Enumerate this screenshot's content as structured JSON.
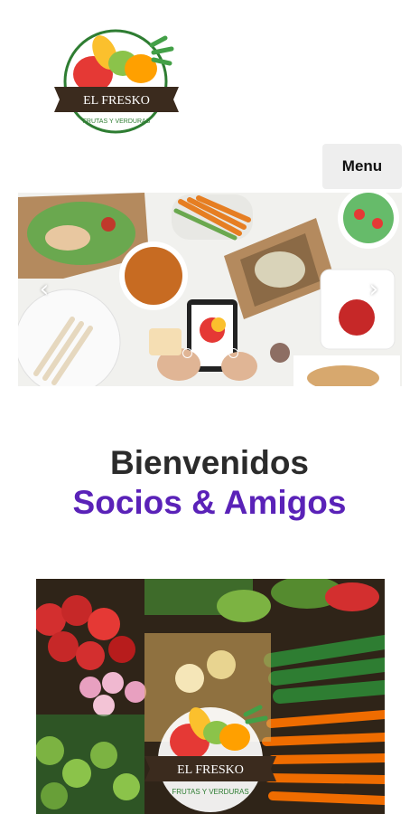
{
  "brand": {
    "name": "EL FRESKO",
    "tagline": "FRUTAS Y VERDURAS"
  },
  "header": {
    "menu_label": "Menu"
  },
  "carousel": {
    "prev_icon": "chevron-left-icon",
    "next_icon": "chevron-right-icon",
    "slide_count": 3,
    "active_slide": 2
  },
  "welcome": {
    "title": "Bienvenidos",
    "subtitle": "Socios & Amigos"
  },
  "colors": {
    "subtitle": "#5a22b8",
    "title": "#2b2b2b",
    "menu_bg": "#eeeeee",
    "logo_green": "#2e7d32",
    "logo_band": "#3b2b1e"
  }
}
